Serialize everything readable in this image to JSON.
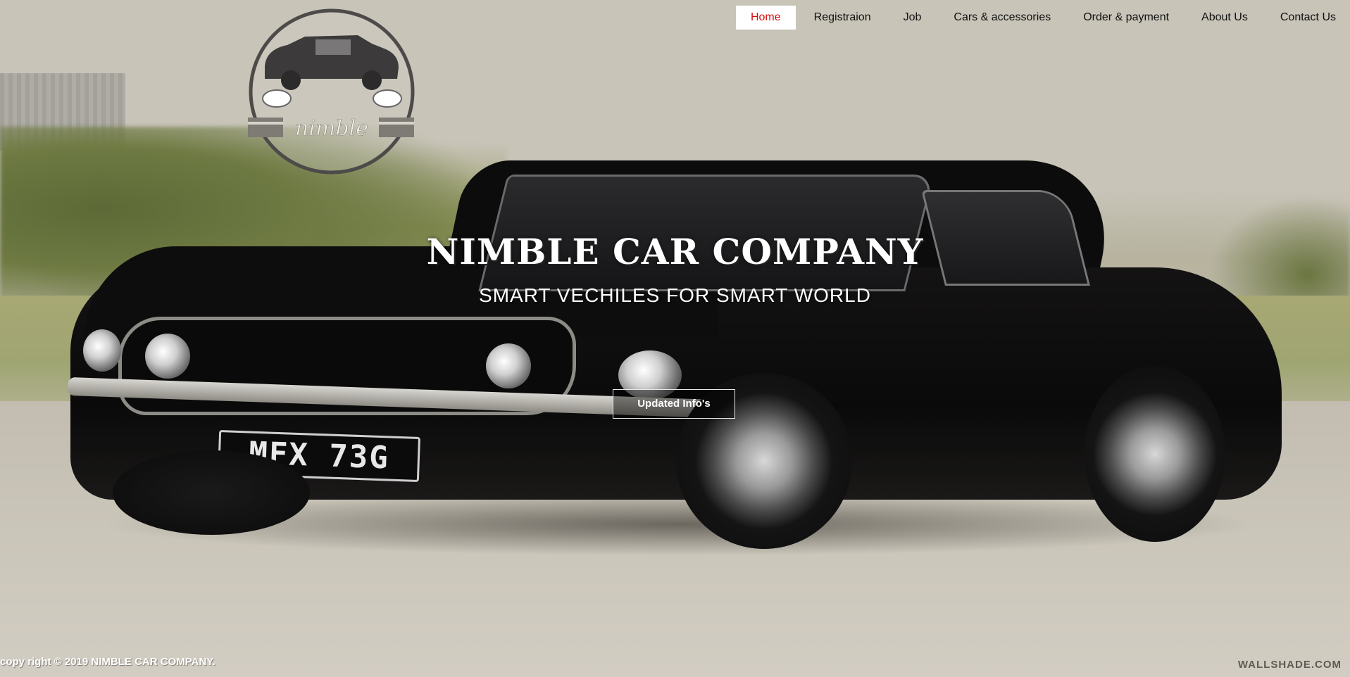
{
  "nav": {
    "items": [
      {
        "label": "Home",
        "active": true
      },
      {
        "label": "Registraion",
        "active": false
      },
      {
        "label": "Job",
        "active": false
      },
      {
        "label": "Cars & accessories",
        "active": false
      },
      {
        "label": "Order & payment",
        "active": false
      },
      {
        "label": "About Us",
        "active": false
      },
      {
        "label": "Contact Us",
        "active": false
      }
    ]
  },
  "logo": {
    "text": "nimble"
  },
  "hero": {
    "title": "NIMBLE CAR COMPANY",
    "subtitle": "SMART VECHILES FOR SMART WORLD",
    "cta_label": "Updated Info's"
  },
  "car": {
    "plate": "MFX 73G"
  },
  "footer": {
    "copyright": "copy right © 2019 NIMBLE CAR COMPANY."
  },
  "watermark": "WALLSHADE.COM",
  "colors": {
    "nav_active_bg": "#ffffff",
    "nav_active_text": "#d40f0f",
    "hero_text": "#ffffff"
  }
}
